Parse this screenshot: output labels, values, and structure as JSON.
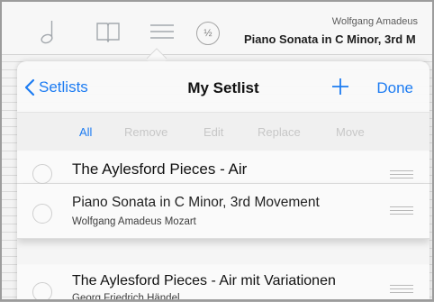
{
  "toolbar": {
    "icons": [
      "music-note-icon",
      "book-icon",
      "list-icon"
    ],
    "half_badge": "½",
    "piece": {
      "composer": "Wolfgang Amadeus",
      "title": "Piano Sonata in C Minor, 3rd M"
    }
  },
  "popover": {
    "back_label": "Setlists",
    "title": "My Setlist",
    "add_icon": "plus-icon",
    "done_label": "Done",
    "accent_color": "#1d7cf2",
    "segments": [
      "All",
      "Remove",
      "Edit",
      "Replace",
      "Move"
    ],
    "active_segment": "All"
  },
  "rows": [
    {
      "title": "The Aylesford Pieces - Air",
      "subtitle": ""
    },
    {
      "title": "Piano Sonata in C Minor, 3rd Movement",
      "subtitle": "Wolfgang Amadeus Mozart"
    },
    {
      "title": "The Aylesford Pieces - Air mit Variationen",
      "subtitle": "Georg Friedrich Händel"
    }
  ]
}
